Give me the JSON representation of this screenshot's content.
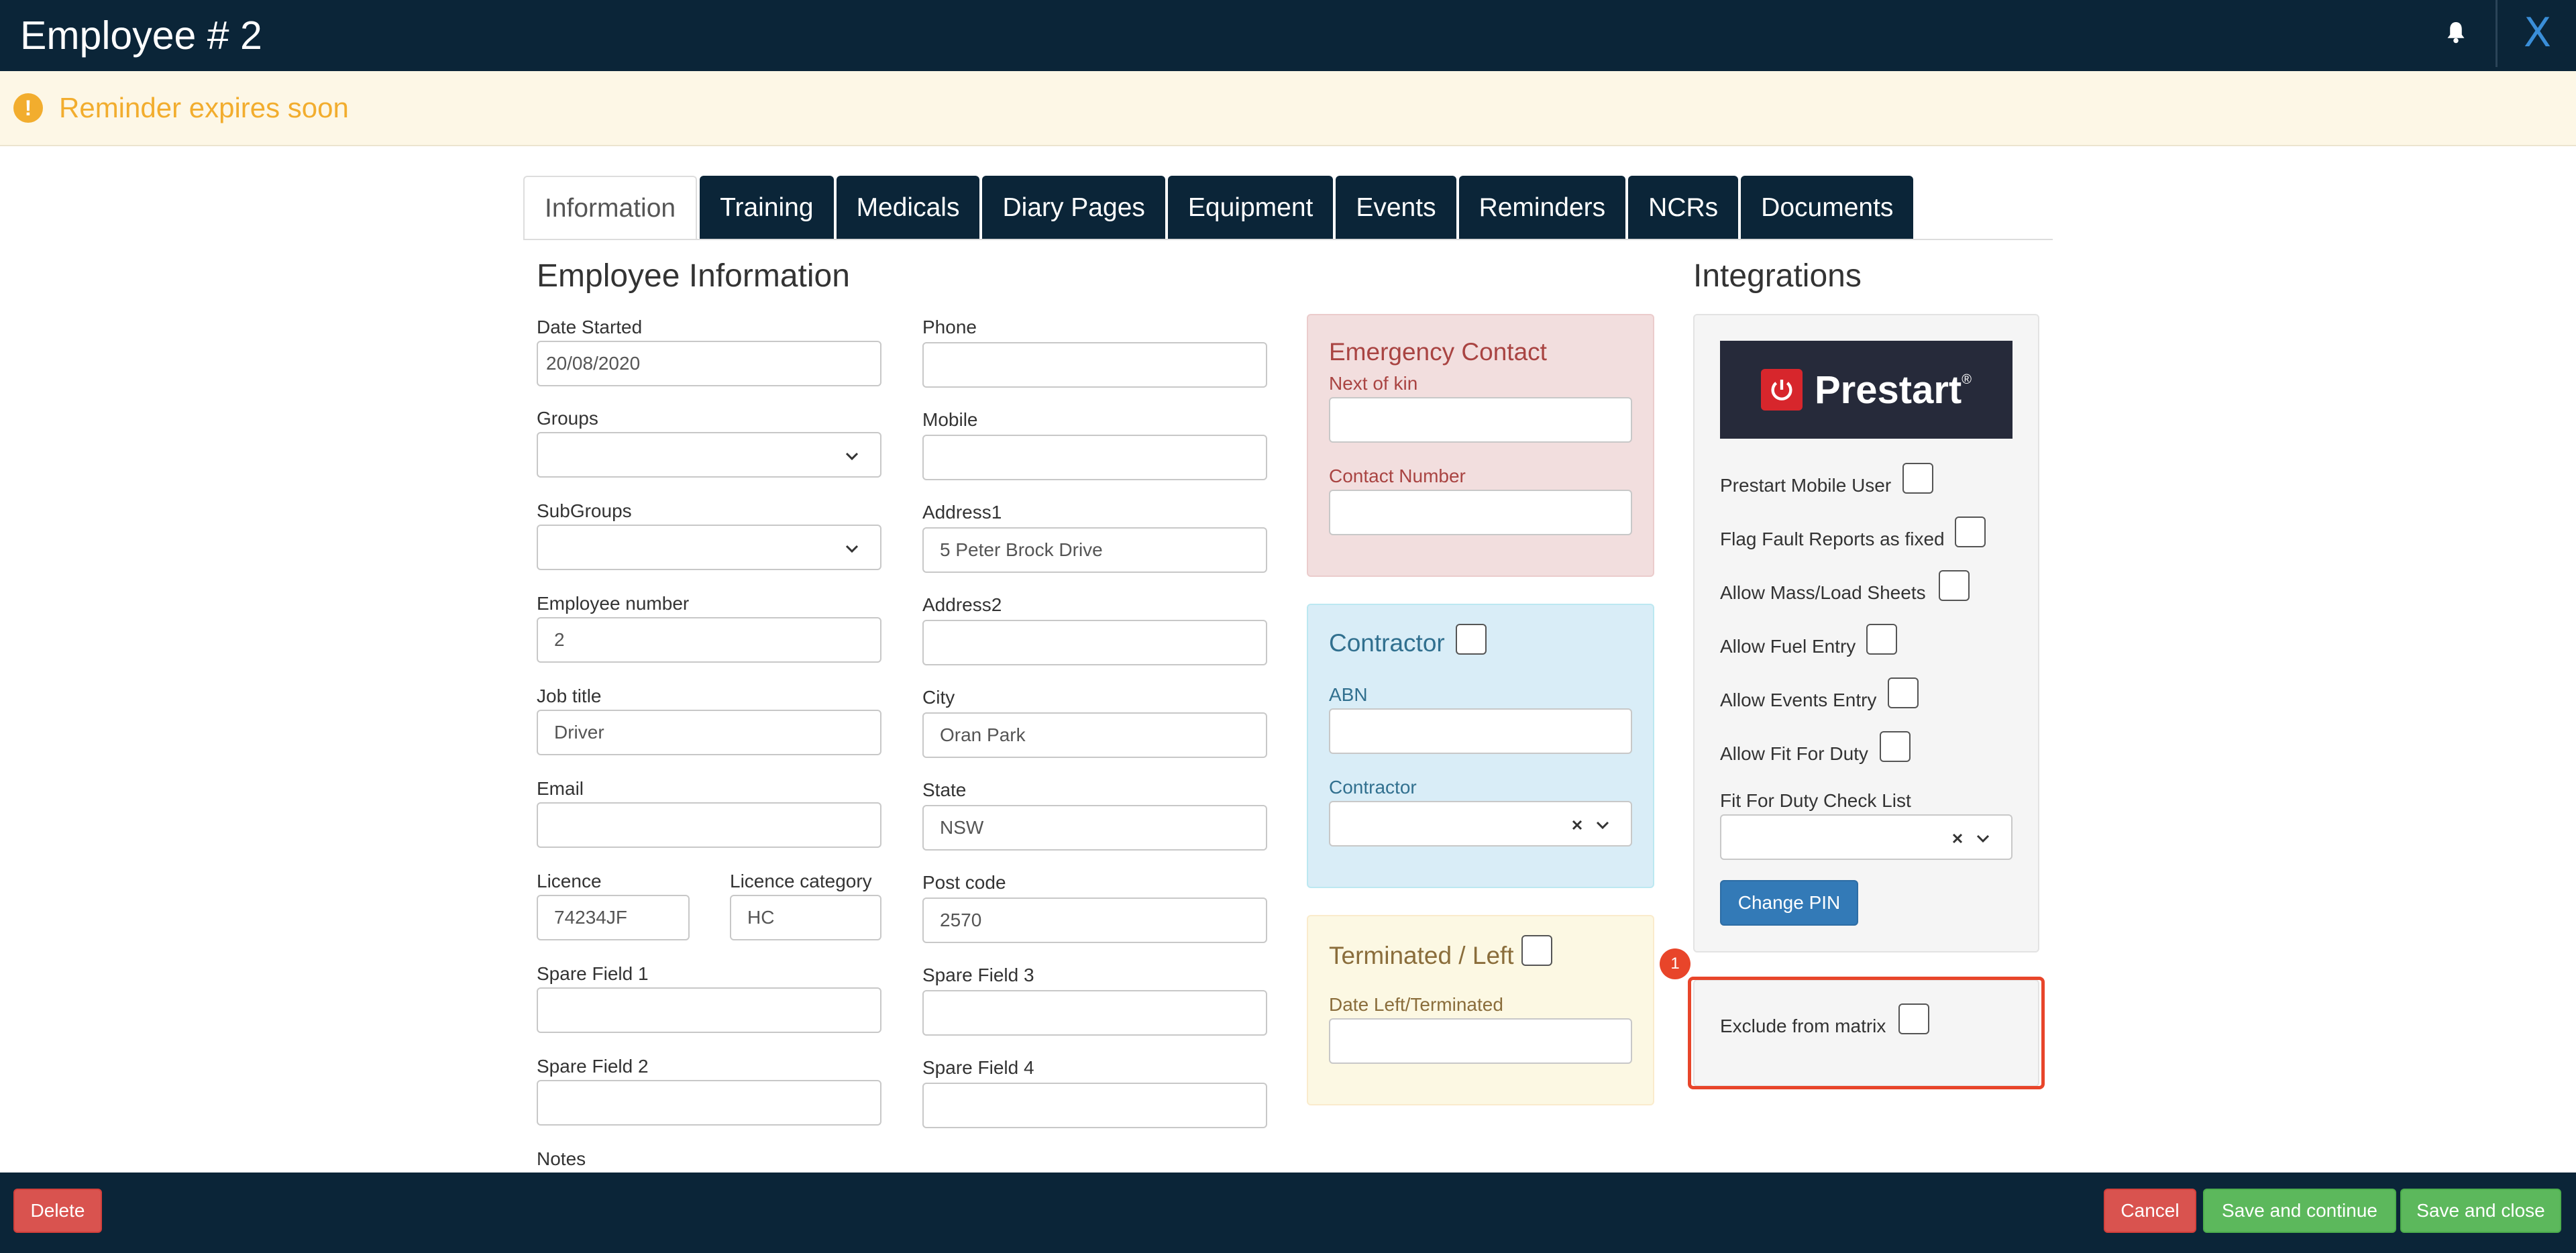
{
  "header": {
    "title": "Employee # 2",
    "close_label": "X"
  },
  "reminder": {
    "text": "Reminder expires soon"
  },
  "tabs": [
    {
      "label": "Information",
      "active": true
    },
    {
      "label": "Training"
    },
    {
      "label": "Medicals"
    },
    {
      "label": "Diary Pages"
    },
    {
      "label": "Equipment"
    },
    {
      "label": "Events"
    },
    {
      "label": "Reminders"
    },
    {
      "label": "NCRs"
    },
    {
      "label": "Documents"
    }
  ],
  "info": {
    "title": "Employee Information",
    "date_started": {
      "label": "Date Started",
      "value": "20/08/2020"
    },
    "groups": {
      "label": "Groups",
      "value": ""
    },
    "subgroups": {
      "label": "SubGroups",
      "value": ""
    },
    "employee_number": {
      "label": "Employee number",
      "value": "2"
    },
    "job_title": {
      "label": "Job title",
      "value": "Driver"
    },
    "email": {
      "label": "Email",
      "value": ""
    },
    "licence": {
      "label": "Licence",
      "value": "74234JF"
    },
    "licence_category": {
      "label": "Licence category",
      "value": "HC"
    },
    "spare1": {
      "label": "Spare Field 1",
      "value": ""
    },
    "spare2": {
      "label": "Spare Field 2",
      "value": ""
    },
    "notes": {
      "label": "Notes"
    },
    "phone": {
      "label": "Phone",
      "value": ""
    },
    "mobile": {
      "label": "Mobile",
      "value": ""
    },
    "address1": {
      "label": "Address1",
      "value": "5 Peter Brock Drive"
    },
    "address2": {
      "label": "Address2",
      "value": ""
    },
    "city": {
      "label": "City",
      "value": "Oran Park"
    },
    "state": {
      "label": "State",
      "value": "NSW"
    },
    "postcode": {
      "label": "Post code",
      "value": "2570"
    },
    "spare3": {
      "label": "Spare Field 3",
      "value": ""
    },
    "spare4": {
      "label": "Spare Field 4",
      "value": ""
    }
  },
  "emergency": {
    "title": "Emergency Contact",
    "next_of_kin": "Next of kin",
    "contact_number": "Contact Number"
  },
  "contractor": {
    "title": "Contractor",
    "abn": "ABN",
    "contractor_label": "Contractor"
  },
  "terminated": {
    "title": "Terminated / Left",
    "date_label": "Date Left/Terminated"
  },
  "integrations": {
    "title": "Integrations",
    "logo_text": "Prestart",
    "logo_mark": "®",
    "prestart_mobile_user": "Prestart Mobile User",
    "flag_fault": "Flag Fault Reports as fixed",
    "allow_mass": "Allow Mass/Load Sheets",
    "allow_fuel": "Allow Fuel Entry",
    "allow_events": "Allow Events Entry",
    "allow_fit": "Allow Fit For Duty",
    "fit_checklist": "Fit For Duty Check List",
    "change_pin": "Change PIN",
    "exclude_matrix": "Exclude from matrix"
  },
  "marker": {
    "number": "1"
  },
  "footer": {
    "delete": "Delete",
    "cancel": "Cancel",
    "save_continue": "Save and continue",
    "save_close": "Save and close"
  },
  "colors": {
    "navy": "#0b2538",
    "warning": "#f2ad2e",
    "highlight": "#e8452a"
  }
}
